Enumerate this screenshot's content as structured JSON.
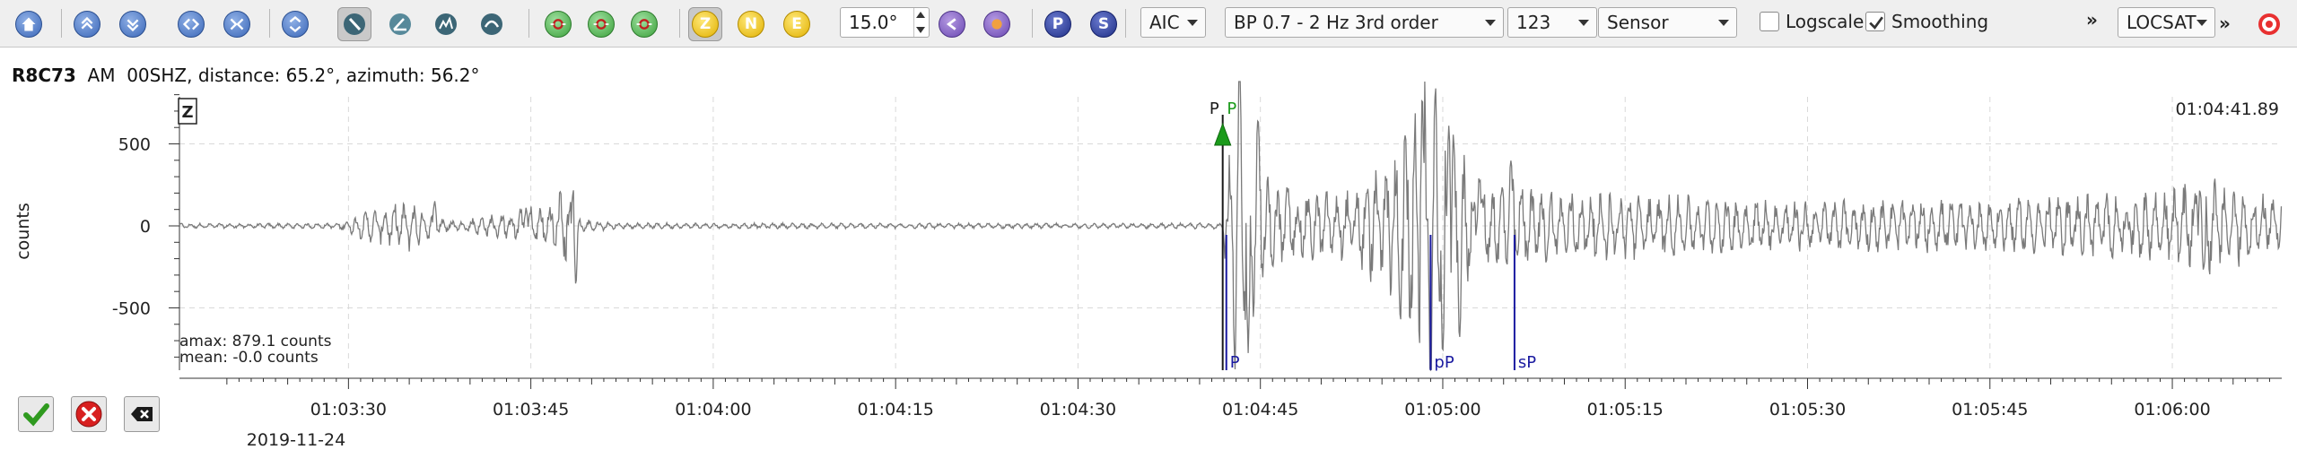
{
  "toolbar": {
    "tools": [
      {
        "name": "home-icon",
        "color": "#3b67b8"
      },
      {
        "name": "scroll-up-icon",
        "color": "#3b67b8"
      },
      {
        "name": "scroll-down-icon",
        "color": "#3b67b8"
      },
      {
        "name": "zoom-in-horizontal-icon",
        "color": "#3b67b8"
      },
      {
        "name": "zoom-out-horizontal-icon",
        "color": "#3b67b8"
      },
      {
        "name": "zoom-vertical-icon",
        "color": "#3b67b8"
      },
      {
        "name": "pick-tool-icon",
        "pressed": true
      },
      {
        "name": "measure-tool-icon"
      },
      {
        "name": "spectrum-tool-icon"
      },
      {
        "name": "filter-tool-icon"
      }
    ],
    "alignment_buttons": [
      {
        "name": "align-on-origin-icon",
        "color": "#3aa03a"
      },
      {
        "name": "align-on-pick-icon",
        "color": "#3aa03a"
      },
      {
        "name": "align-on-theoretical-icon",
        "color": "#3aa03a"
      }
    ],
    "components": [
      {
        "label": "Z",
        "pressed": true
      },
      {
        "label": "N",
        "pressed": false
      },
      {
        "label": "E",
        "pressed": false
      }
    ],
    "rotation_value": "15.0°",
    "auto_pick_buttons": [
      {
        "name": "autopick-rotate-left-icon"
      },
      {
        "name": "autopick-rotate-right-icon"
      }
    ],
    "phase_buttons": [
      {
        "label": "P",
        "color": "#1f2f86"
      },
      {
        "label": "S",
        "color": "#1f2f86"
      }
    ],
    "picker_method": "AIC",
    "filter": "BP 0.7 - 2 Hz  3rd order",
    "components_combo": "123",
    "unit_mode": "Sensor",
    "logscale_label": "Logscale",
    "logscale_checked": false,
    "smoothing_label": "Smoothing",
    "smoothing_checked": true,
    "overflow": "»",
    "locator": "LOCSAT",
    "locator_overflow": "»"
  },
  "trace": {
    "station_code": "R8C73",
    "network": "AM",
    "channel": "00SHZ",
    "distance_label": "distance: 65.2°, azimuth: 56.2°",
    "component": "Z",
    "time_readout": "01:04:41.89",
    "y_axis_label": "counts",
    "amax": "amax: 879.1 counts",
    "mean": "mean: -0.0 counts",
    "date": "2019-11-24"
  },
  "chart_data": {
    "type": "line",
    "title": "",
    "xlabel": "",
    "ylabel": "counts",
    "x_ticks": [
      "01:03:30",
      "01:03:45",
      "01:04:00",
      "01:04:15",
      "01:04:30",
      "01:04:45",
      "01:05:00",
      "01:05:15",
      "01:05:30",
      "01:05:45",
      "01:06:00"
    ],
    "x_tick_seconds": [
      0,
      15,
      30,
      45,
      60,
      75,
      90,
      105,
      120,
      135,
      150
    ],
    "xlim_seconds": [
      -13.9,
      159.0
    ],
    "y_ticks": [
      500,
      0,
      -500
    ],
    "ylim": [
      -880,
      880
    ],
    "grid": true,
    "picks": [
      {
        "label": "P",
        "t": 71.9,
        "color": "#1a1a1a"
      },
      {
        "label": "P",
        "t": 72.1,
        "color": "#1a9a1a"
      }
    ],
    "theoretical_arrivals": [
      {
        "label": "P",
        "t": 72.2,
        "color": "#1a1aa0"
      },
      {
        "label": "pP",
        "t": 89.0,
        "color": "#1a1aa0"
      },
      {
        "label": "sP",
        "t": 95.9,
        "color": "#1a1aa0"
      }
    ],
    "series": [
      {
        "color": "#7a7a7a",
        "envelope": [
          [
            -14,
            14
          ],
          [
            -1,
            14
          ],
          [
            1.5,
            80
          ],
          [
            5,
            140
          ],
          [
            7,
            60
          ],
          [
            9,
            25
          ],
          [
            12,
            70
          ],
          [
            16,
            120
          ],
          [
            18,
            230
          ],
          [
            19,
            40
          ],
          [
            22,
            16
          ],
          [
            60,
            14
          ],
          [
            71.8,
            16
          ],
          [
            72.3,
            300
          ],
          [
            73.3,
            780
          ],
          [
            74.5,
            500
          ],
          [
            76,
            240
          ],
          [
            78,
            200
          ],
          [
            82,
            180
          ],
          [
            86,
            420
          ],
          [
            88.5,
            780
          ],
          [
            89.5,
            760
          ],
          [
            91.5,
            420
          ],
          [
            93,
            220
          ],
          [
            95.5,
            300
          ],
          [
            97,
            200
          ],
          [
            102,
            200
          ],
          [
            110,
            160
          ],
          [
            120,
            140
          ],
          [
            135,
            140
          ],
          [
            150,
            200
          ],
          [
            152,
            280
          ],
          [
            159,
            140
          ]
        ],
        "peaks": [
          [
            72.9,
            -760
          ],
          [
            73.3,
            879
          ],
          [
            74.0,
            -880
          ],
          [
            74.8,
            620
          ],
          [
            86.5,
            -420
          ],
          [
            88.3,
            740
          ],
          [
            89.0,
            -820
          ],
          [
            89.4,
            700
          ],
          [
            90.0,
            -870
          ],
          [
            90.5,
            660
          ],
          [
            91.4,
            -600
          ],
          [
            93.0,
            340
          ],
          [
            95.6,
            340
          ],
          [
            152.3,
            280
          ],
          [
            152.6,
            -320
          ],
          [
            18.5,
            230
          ],
          [
            18.7,
            -335
          ],
          [
            7.1,
            150
          ],
          [
            14.6,
            120
          ]
        ]
      }
    ]
  },
  "bottom_buttons": [
    {
      "name": "accept-check-icon"
    },
    {
      "name": "reject-x-icon"
    },
    {
      "name": "clear-icon"
    }
  ]
}
